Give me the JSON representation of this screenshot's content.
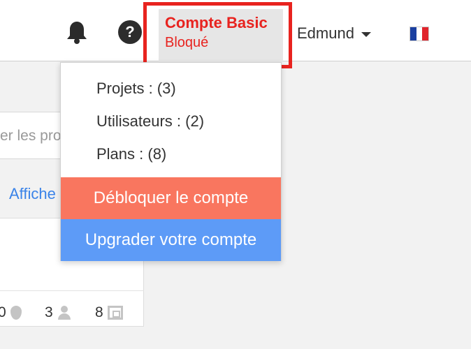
{
  "navbar": {
    "bell_icon": "bell-icon",
    "help_icon": "help-icon",
    "help_glyph": "?",
    "account": {
      "title": "Compte Basic",
      "status": "Bloqué",
      "highlight_color": "#e8231f"
    },
    "user_name": "Edmund",
    "language_flag": "france-flag-icon"
  },
  "dropdown": {
    "items": [
      {
        "label": "Projets : (3)"
      },
      {
        "label": "Utilisateurs : (2)"
      },
      {
        "label": "Plans : (8)"
      }
    ],
    "unlock_label": "Débloquer le compte",
    "unlock_color": "#f9765f",
    "upgrade_label": "Upgrader votre compte",
    "upgrade_color": "#5d9bf7"
  },
  "background": {
    "search_placeholder": "er les pro",
    "show_link": "Affiche",
    "card_stats": [
      {
        "value": "0",
        "icon": "pin-icon"
      },
      {
        "value": "3",
        "icon": "user-icon"
      },
      {
        "value": "8",
        "icon": "plan-icon"
      }
    ]
  }
}
